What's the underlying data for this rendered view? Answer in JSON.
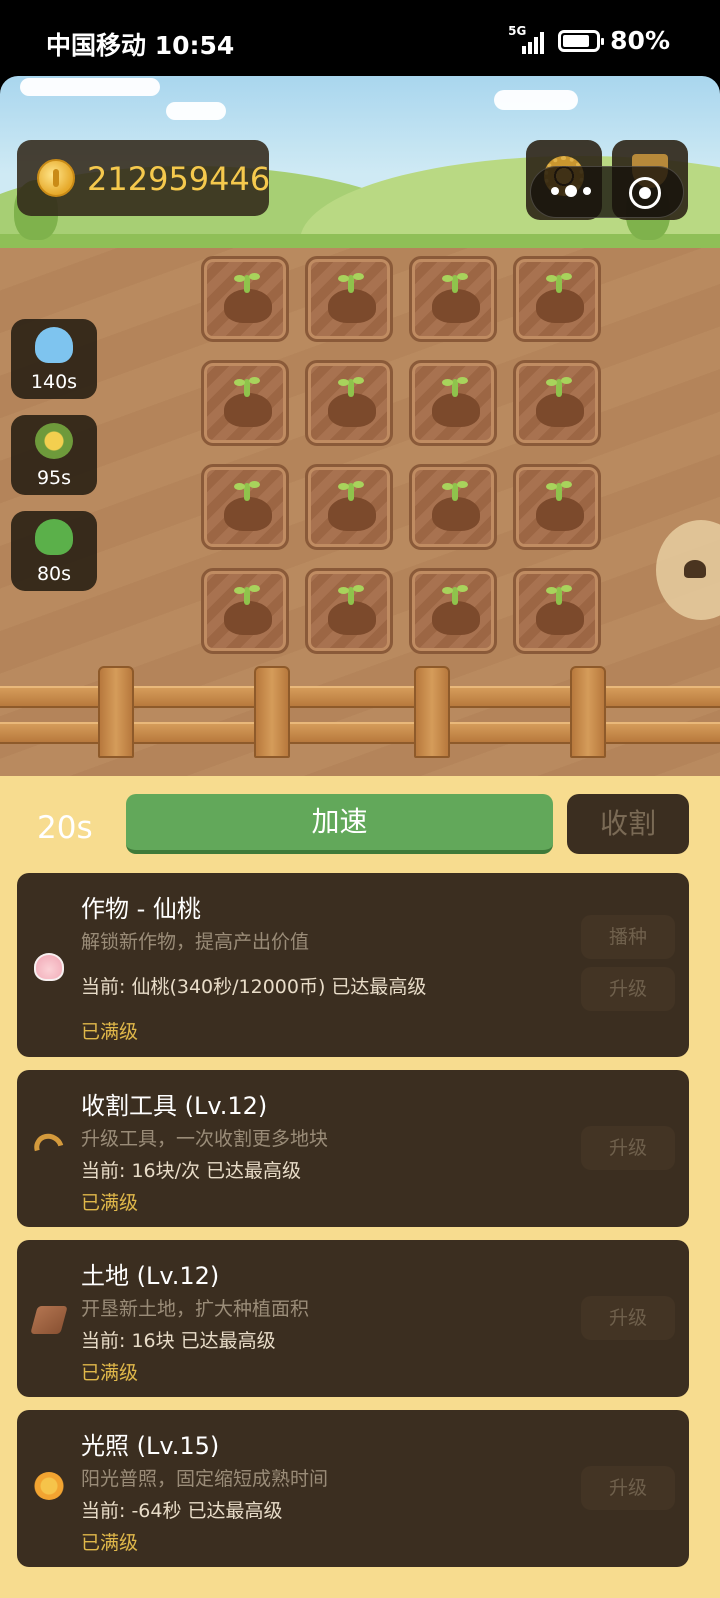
{
  "status_bar": {
    "carrier_time": "中国移动 10:54",
    "network": "5G",
    "battery": "80%",
    "battery_level": 0.8
  },
  "game": {
    "coins": "212959446",
    "buffs": [
      {
        "icon": "rain-cloud-icon",
        "time": "140s"
      },
      {
        "icon": "medal-icon",
        "time": "95s"
      },
      {
        "icon": "frog-icon",
        "time": "80s"
      }
    ],
    "plots_rows": 4,
    "plots_cols": 4
  },
  "actions": {
    "timer": "20s",
    "speed_up": "加速",
    "harvest": "收割"
  },
  "upgrades": [
    {
      "icon": "peach-icon",
      "title": "作物 - 仙桃",
      "desc": "解锁新作物，提高产出价值",
      "current": "当前: 仙桃(340秒/12000币) 已达最高级",
      "status": "已满级",
      "buttons": [
        "播种",
        "升级"
      ]
    },
    {
      "icon": "sickle-icon",
      "title": "收割工具 (Lv.12)",
      "desc": "升级工具，一次收割更多地块",
      "current": "当前: 16块/次  已达最高级",
      "status": "已满级",
      "buttons": [
        "升级"
      ]
    },
    {
      "icon": "land-icon",
      "title": "土地 (Lv.12)",
      "desc": "开垦新土地，扩大种植面积",
      "current": "当前: 16块  已达最高级",
      "status": "已满级",
      "buttons": [
        "升级"
      ]
    },
    {
      "icon": "sun-icon",
      "title": "光照 (Lv.15)",
      "desc": "阳光普照，固定缩短成熟时间",
      "current": "当前: -64秒  已达最高级",
      "status": "已满级",
      "buttons": [
        "升级"
      ]
    }
  ]
}
